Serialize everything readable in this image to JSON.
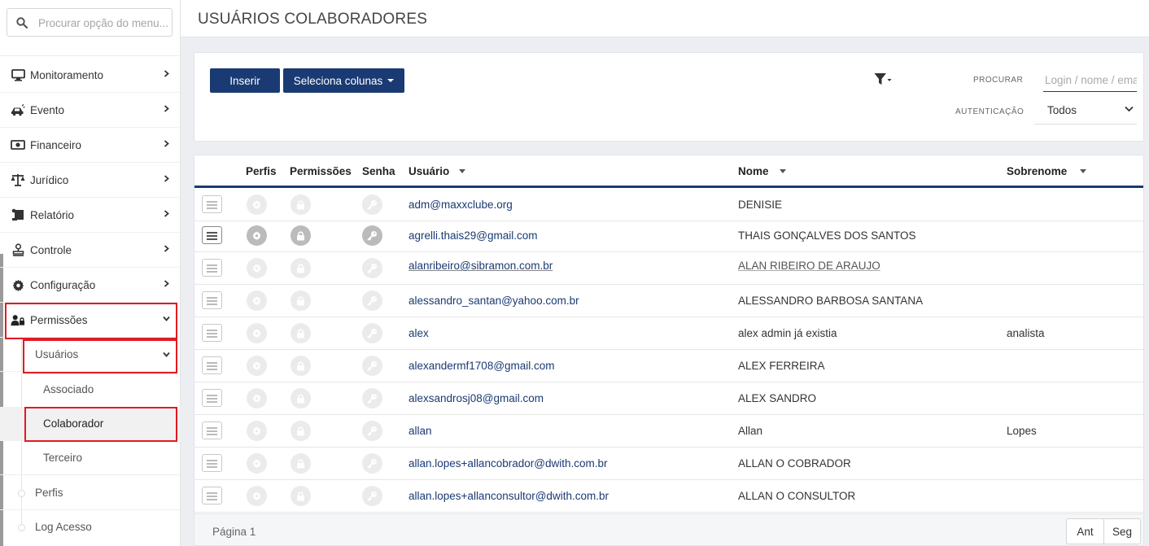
{
  "sidebar": {
    "search_placeholder": "Procurar opção do menu...",
    "menu": [
      {
        "label": "Monitoramento",
        "icon": "monitor-icon"
      },
      {
        "label": "Evento",
        "icon": "car-crash-icon"
      },
      {
        "label": "Financeiro",
        "icon": "money-bill-icon"
      },
      {
        "label": "Jurídico",
        "icon": "scale-icon"
      },
      {
        "label": "Relatório",
        "icon": "report-scroll-icon"
      },
      {
        "label": "Controle",
        "icon": "stamp-icon"
      },
      {
        "label": "Configuração",
        "icon": "gear-icon"
      },
      {
        "label": "Permissões",
        "icon": "user-lock-icon",
        "expanded": true
      }
    ],
    "submenu": {
      "usuarios": "Usuários",
      "associado": "Associado",
      "colaborador": "Colaborador",
      "terceiro": "Terceiro",
      "perfis": "Perfis",
      "log_acesso": "Log Acesso"
    }
  },
  "header": {
    "title": "USUÁRIOS COLABORADORES"
  },
  "toolbar": {
    "insert_label": "Inserir",
    "columns_label": "Seleciona colunas",
    "search_label": "PROCURAR",
    "search_placeholder": "Login / nome / email",
    "auth_label": "AUTENTICAÇÃO",
    "auth_value": "Todos"
  },
  "table": {
    "columns": {
      "perfis": "Perfis",
      "permissoes": "Permissões",
      "senha": "Senha",
      "usuario": "Usuário",
      "nome": "Nome",
      "sobrenome": "Sobrenome"
    },
    "rows": [
      {
        "usuario": "adm@maxxclube.org",
        "nome": "DENISIE",
        "sobrenome": ""
      },
      {
        "usuario": "agrelli.thais29@gmail.com",
        "nome": "THAIS GONÇALVES DOS SANTOS",
        "sobrenome": ""
      },
      {
        "usuario": "alanribeiro@sibramon.com.br",
        "nome": "ALAN RIBEIRO DE ARAUJO",
        "sobrenome": ""
      },
      {
        "usuario": "alessandro_santan@yahoo.com.br",
        "nome": "ALESSANDRO BARBOSA SANTANA",
        "sobrenome": ""
      },
      {
        "usuario": "alex",
        "nome": "alex admin já existia",
        "sobrenome": "analista"
      },
      {
        "usuario": "alexandermf1708@gmail.com",
        "nome": "ALEX FERREIRA",
        "sobrenome": ""
      },
      {
        "usuario": "alexsandrosj08@gmail.com",
        "nome": "ALEX SANDRO",
        "sobrenome": ""
      },
      {
        "usuario": "allan",
        "nome": "Allan",
        "sobrenome": "Lopes"
      },
      {
        "usuario": "allan.lopes+allancobrador@dwith.com.br",
        "nome": "ALLAN O COBRADOR",
        "sobrenome": ""
      },
      {
        "usuario": "allan.lopes+allanconsultor@dwith.com.br",
        "nome": "ALLAN O CONSULTOR",
        "sobrenome": ""
      }
    ],
    "footer": {
      "page_label": "Página 1",
      "prev_label": "Ant",
      "next_label": "Seg"
    }
  },
  "colors": {
    "primary": "#1a3a73",
    "highlight_border": "#e01b24"
  }
}
